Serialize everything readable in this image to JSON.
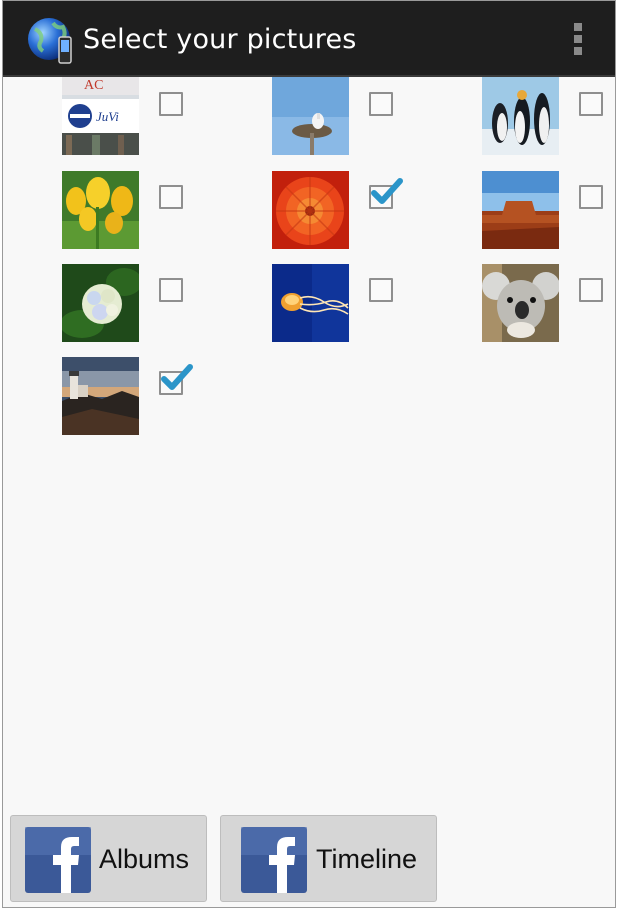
{
  "app": {
    "title": "Select your pictures",
    "icon": "globe-phone-icon",
    "menu_icon": "overflow-menu-icon"
  },
  "photos": [
    {
      "name": "sign-photo",
      "checked": false
    },
    {
      "name": "stork-nest-photo",
      "checked": false
    },
    {
      "name": "penguins-photo",
      "checked": false
    },
    {
      "name": "tulips-photo",
      "checked": false
    },
    {
      "name": "chrysanthemum-photo",
      "checked": true
    },
    {
      "name": "desert-photo",
      "checked": false
    },
    {
      "name": "hydrangeas-photo",
      "checked": false
    },
    {
      "name": "jellyfish-photo",
      "checked": false
    },
    {
      "name": "koala-photo",
      "checked": false
    },
    {
      "name": "lighthouse-photo",
      "checked": true
    }
  ],
  "buttons": {
    "albums": "Albums",
    "timeline": "Timeline"
  },
  "colors": {
    "actionbar": "#1e1e1e",
    "check_accent": "#2b95c9",
    "facebook_blue": "#3b5998"
  }
}
